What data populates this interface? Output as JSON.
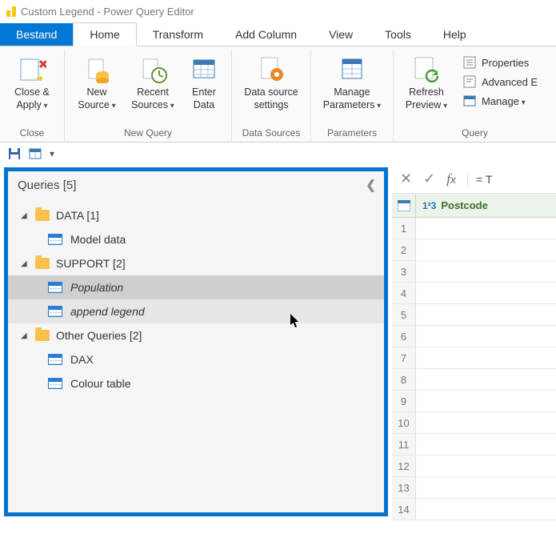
{
  "window": {
    "title": "Custom Legend - Power Query Editor"
  },
  "tabs": {
    "file": "Bestand",
    "home": "Home",
    "transform": "Transform",
    "addcolumn": "Add Column",
    "view": "View",
    "tools": "Tools",
    "help": "Help"
  },
  "ribbon": {
    "close": {
      "close_apply": "Close &\nApply",
      "group": "Close"
    },
    "newquery": {
      "new_source": "New\nSource",
      "recent_sources": "Recent\nSources",
      "enter_data": "Enter\nData",
      "group": "New Query"
    },
    "datasources": {
      "data_source_settings": "Data source\nsettings",
      "group": "Data Sources"
    },
    "parameters": {
      "manage_parameters": "Manage\nParameters",
      "group": "Parameters"
    },
    "query": {
      "refresh_preview": "Refresh\nPreview",
      "properties": "Properties",
      "advanced_editor": "Advanced E",
      "manage": "Manage",
      "group": "Query"
    }
  },
  "queries": {
    "header": "Queries [5]",
    "folders": [
      {
        "name": "DATA [1]",
        "items": [
          {
            "label": "Model data",
            "state": "none"
          }
        ]
      },
      {
        "name": "SUPPORT [2]",
        "items": [
          {
            "label": "Population",
            "state": "selected"
          },
          {
            "label": "append legend",
            "state": "hover"
          }
        ]
      },
      {
        "name": "Other Queries [2]",
        "items": [
          {
            "label": "DAX",
            "state": "none"
          },
          {
            "label": "Colour table",
            "state": "none"
          }
        ]
      }
    ]
  },
  "formula": {
    "text": "= T"
  },
  "grid": {
    "col_type": "1²3",
    "col_name": "Postcode",
    "rows": [
      "1",
      "2",
      "3",
      "4",
      "5",
      "6",
      "7",
      "8",
      "9",
      "10",
      "11",
      "12",
      "13",
      "14"
    ]
  }
}
